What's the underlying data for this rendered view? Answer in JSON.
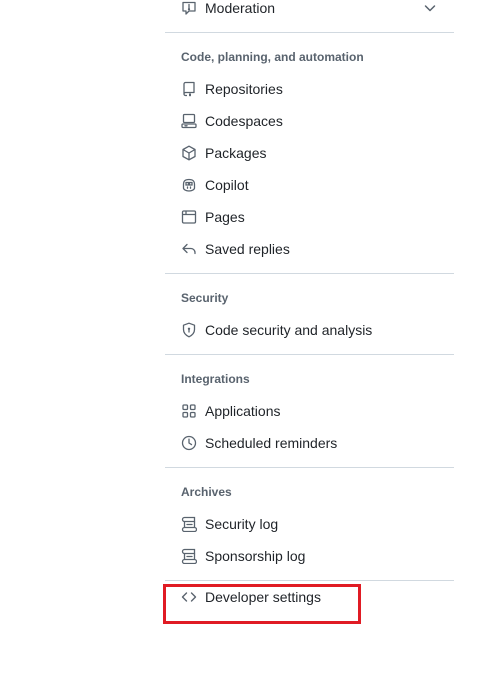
{
  "nav": {
    "moderation": {
      "label": "Moderation",
      "icon": "comment-alert-icon"
    },
    "sections": [
      {
        "heading": "Code, planning, and automation",
        "items": [
          {
            "label": "Repositories",
            "icon": "repo-icon"
          },
          {
            "label": "Codespaces",
            "icon": "codespaces-icon"
          },
          {
            "label": "Packages",
            "icon": "package-icon"
          },
          {
            "label": "Copilot",
            "icon": "copilot-icon"
          },
          {
            "label": "Pages",
            "icon": "browser-icon"
          },
          {
            "label": "Saved replies",
            "icon": "reply-icon"
          }
        ]
      },
      {
        "heading": "Security",
        "items": [
          {
            "label": "Code security and analysis",
            "icon": "shield-lock-icon"
          }
        ]
      },
      {
        "heading": "Integrations",
        "items": [
          {
            "label": "Applications",
            "icon": "apps-icon"
          },
          {
            "label": "Scheduled reminders",
            "icon": "clock-icon"
          }
        ]
      },
      {
        "heading": "Archives",
        "items": [
          {
            "label": "Security log",
            "icon": "log-icon"
          },
          {
            "label": "Sponsorship log",
            "icon": "log-icon"
          }
        ]
      }
    ],
    "developer_settings": {
      "label": "Developer settings",
      "icon": "code-icon"
    }
  },
  "colors": {
    "text": "#1f2328",
    "muted": "#59636e",
    "divider": "#d1d9e0",
    "highlight": "#e01b24"
  }
}
